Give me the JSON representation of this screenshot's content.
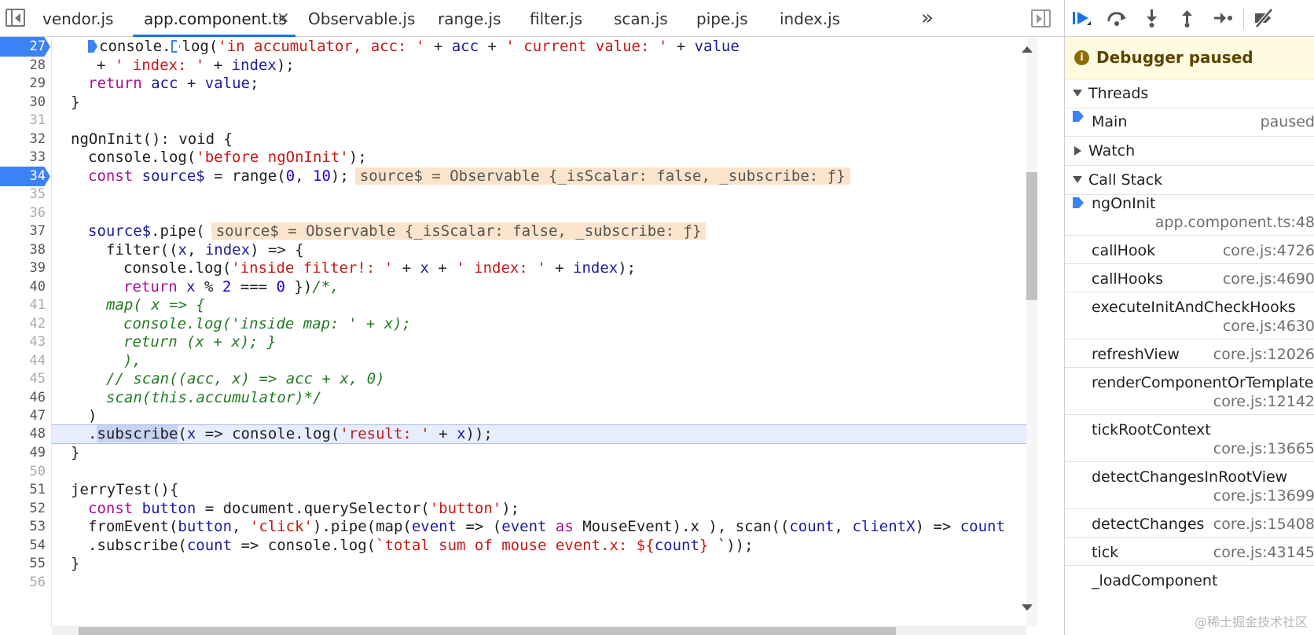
{
  "tabs": [
    {
      "label": "vendor.js",
      "active": false
    },
    {
      "label": "app.component.ts",
      "active": true
    },
    {
      "label": "Observable.js",
      "active": false
    },
    {
      "label": "range.js",
      "active": false
    },
    {
      "label": "filter.js",
      "active": false
    },
    {
      "label": "scan.js",
      "active": false
    },
    {
      "label": "pipe.js",
      "active": false
    },
    {
      "label": "index.js",
      "active": false
    }
  ],
  "tab_close_glyph": "×",
  "tab_more_glyph": "»",
  "editor": {
    "line_numbers": [
      "27",
      "28",
      "29",
      "30",
      "31",
      "32",
      "33",
      "34",
      "35",
      "36",
      "37",
      "38",
      "39",
      "40",
      "41",
      "42",
      "43",
      "44",
      "45",
      "46",
      "47",
      "48",
      "49",
      "50",
      "51",
      "52",
      "53",
      "54",
      "55",
      "56"
    ],
    "breakpoint_lines": [
      "27",
      "34"
    ],
    "current_line": "48",
    "inline_values": {
      "line34": "source$ = Observable {_isScalar: false, _subscribe: ƒ}",
      "line37": "source$ = Observable {_isScalar: false, _subscribe: ƒ}"
    }
  },
  "debugger": {
    "paused_title": "Debugger paused",
    "sections": {
      "threads": "Threads",
      "watch": "Watch",
      "call_stack": "Call Stack"
    },
    "threads": [
      {
        "name": "Main",
        "status": "paused"
      }
    ],
    "call_stack": [
      {
        "name": "ngOnInit",
        "location": "app.component.ts:48"
      },
      {
        "name": "callHook",
        "location": "core.js:4726"
      },
      {
        "name": "callHooks",
        "location": "core.js:4690"
      },
      {
        "name": "executeInitAndCheckHooks",
        "location": "core.js:4630"
      },
      {
        "name": "refreshView",
        "location": "core.js:12026"
      },
      {
        "name": "renderComponentOrTemplate",
        "location": "core.js:12142"
      },
      {
        "name": "tickRootContext",
        "location": "core.js:13665"
      },
      {
        "name": "detectChangesInRootView",
        "location": "core.js:13699"
      },
      {
        "name": "detectChanges",
        "location": "core.js:15408"
      },
      {
        "name": "tick",
        "location": "core.js:43145"
      },
      {
        "name": "_loadComponent",
        "location": ""
      }
    ]
  },
  "watermark": "@稀土掘金技术社区",
  "colors": {
    "accent": "#1a73e8",
    "breakpoint": "#3b82f6",
    "paused_banner_bg": "#fffbe0",
    "inline_value_bg": "#fce4cc",
    "current_line_bg": "#e8edfd"
  }
}
